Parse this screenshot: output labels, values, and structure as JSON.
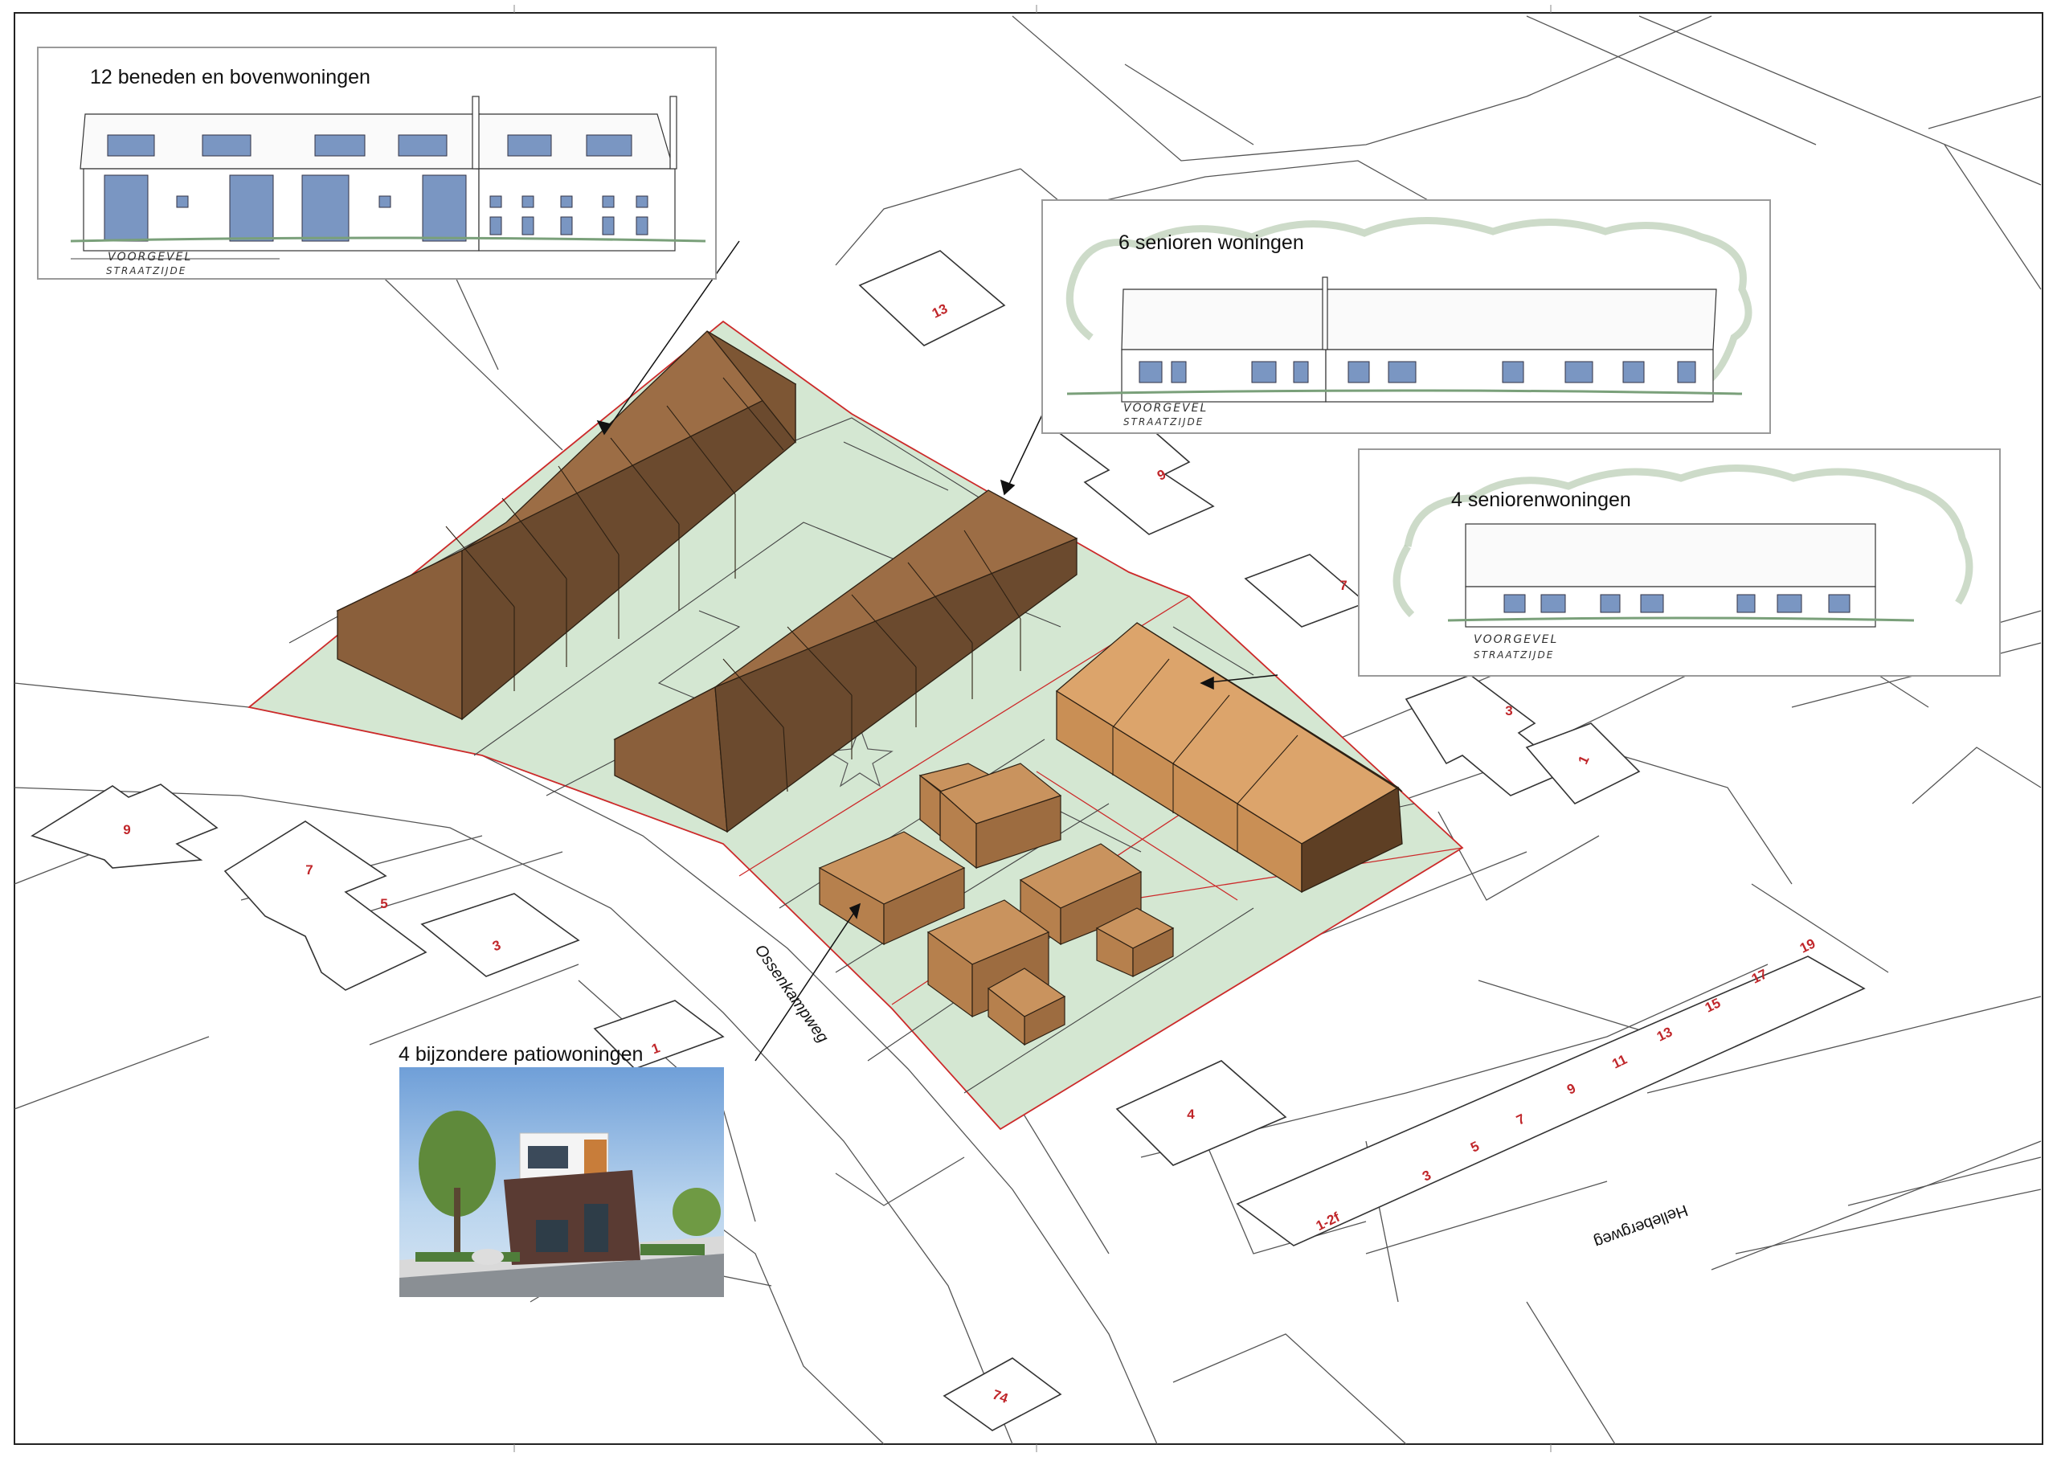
{
  "panels": {
    "rowhouses": {
      "title": "12 beneden en bovenwoningen",
      "note_line1": "VOORGEVEL",
      "note_line2": "STRAATZIJDE"
    },
    "seniors6": {
      "title": "6 senioren woningen",
      "note_line1": "VOORGEVEL",
      "note_line2": "STRAATZIJDE"
    },
    "seniors4": {
      "title": "4 seniorenwoningen",
      "note_line1": "VOORGEVEL",
      "note_line2": "STRAATZIJDE"
    },
    "patio": {
      "title": "4 bijzondere patiowoningen"
    }
  },
  "streets": {
    "ossenkampweg": "Ossenkampweg",
    "hellebergweg": "Hellebergweg"
  },
  "house_numbers": {
    "n13": "13",
    "n9_top": "9",
    "n7_right": "7",
    "n3_right": "3",
    "n1_right": "1",
    "n9_left": "9",
    "n7_left": "7",
    "n5_left": "5",
    "n3_left": "3",
    "n1_left": "1",
    "n4": "4",
    "n74": "74",
    "row": [
      "1-2f",
      "3",
      "5",
      "7",
      "9",
      "11",
      "13",
      "15",
      "17",
      "19"
    ]
  },
  "colors": {
    "site_green": "#d4e7d2",
    "plot_border": "#cc2a2a",
    "roof_brown": "#9c6d45",
    "wall_brown": "#6b4a2e",
    "highlight_roof": "#dca46b",
    "number_red": "#c0262a",
    "road_line": "#555555"
  }
}
